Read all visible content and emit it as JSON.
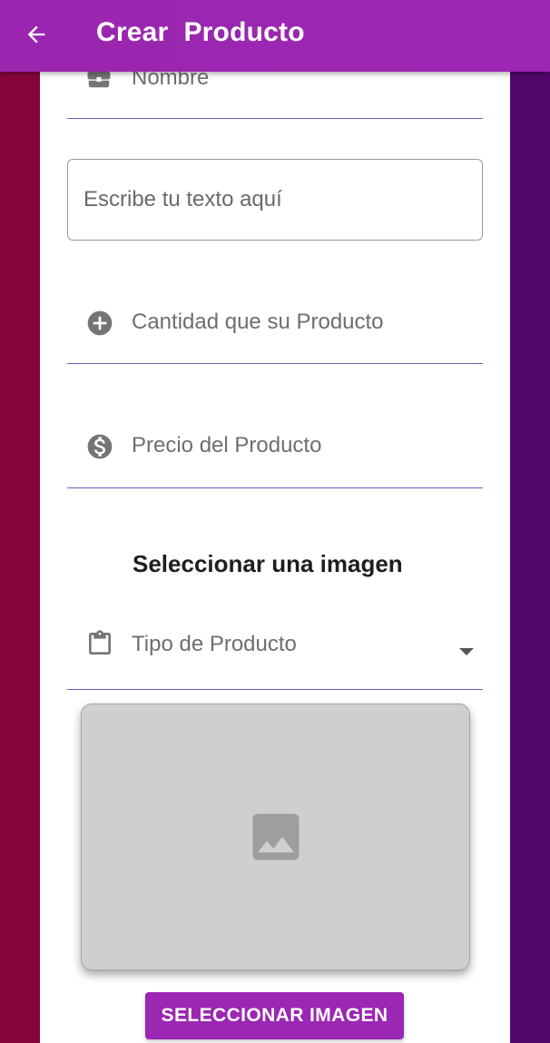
{
  "appbar": {
    "title": "Crear  Producto",
    "back_icon": "arrow-left-icon"
  },
  "colors": {
    "primary": "#9b27b2",
    "left_stripe": "#85043c",
    "right_stripe": "#52066c",
    "underline": "#7a55b8"
  },
  "form": {
    "name_field": {
      "label": "Nombre",
      "icon": "briefcase-icon"
    },
    "text_area": {
      "placeholder": "Escribe tu texto aquí"
    },
    "quantity_field": {
      "label": "Cantidad que su Producto",
      "icon": "add-circle-icon"
    },
    "price_field": {
      "label": "Precio del Producto",
      "icon": "dollar-circle-icon"
    },
    "image_section_title": "Seleccionar una imagen",
    "type_field": {
      "label": "Tipo de Producto",
      "icon": "clipboard-icon"
    },
    "image_placeholder_icon": "image-icon",
    "select_image_button": "SELECCIONAR IMAGEN"
  }
}
